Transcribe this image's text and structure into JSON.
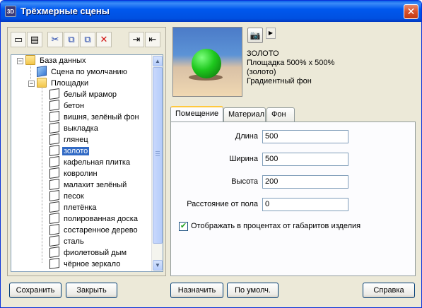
{
  "window": {
    "title": "Трёхмерные сцены",
    "app_icon_text": "3D",
    "close_glyph": "✕",
    "accent": "#0054e3"
  },
  "toolbar": {
    "buttons": [
      {
        "name": "new-icon",
        "glyph": "▭"
      },
      {
        "name": "open-folder-icon",
        "glyph": "▤"
      },
      {
        "name": "cut-icon",
        "glyph": "✂"
      },
      {
        "name": "copy-icon",
        "glyph": "⧉"
      },
      {
        "name": "paste-icon",
        "glyph": "⧉"
      },
      {
        "name": "delete-icon",
        "glyph": "✕"
      },
      {
        "name": "export-icon",
        "glyph": "⇥"
      },
      {
        "name": "import-icon",
        "glyph": "⇤"
      }
    ]
  },
  "tree": {
    "root": "База данных",
    "default_scene": "Сцена по умолчанию",
    "group": "Площадки",
    "items": [
      "белый мрамор",
      "бетон",
      "вишня, зелёный фон",
      "выкладка",
      "глянец",
      "золото",
      "кафельная плитка",
      "ковролин",
      "малахит зелёный",
      "песок",
      "плетёнка",
      "полированная доска",
      "состаренное дерево",
      "сталь",
      "фиолетовый дым",
      "чёрное зеркало"
    ],
    "selected": "золото",
    "expander_minus": "−"
  },
  "scene_info": {
    "name": "ЗОЛОТО",
    "size_line": "Площадка  500% x 500%",
    "material_line": "(золото)",
    "background_line": "Градиентный фон",
    "camera_glyph": "📷",
    "arrow_glyph": "▶"
  },
  "tabs": [
    {
      "label": "Помещение",
      "active": true
    },
    {
      "label": "Материал",
      "active": false
    },
    {
      "label": "Фон",
      "active": false
    }
  ],
  "room": {
    "length_label": "Длина",
    "length_value": "500",
    "width_label": "Ширина",
    "width_value": "500",
    "height_label": "Высота",
    "height_value": "200",
    "floor_distance_label": "Расстояние от пола",
    "floor_distance_value": "0",
    "percent_checkbox_label": "Отображать в процентах от габаритов изделия",
    "percent_checkbox_checked": true,
    "check_glyph": "✔"
  },
  "buttons": {
    "save": "Сохранить",
    "close": "Закрыть",
    "assign": "Назначить",
    "default": "По умолч.",
    "help": "Справка"
  },
  "scrollbar": {
    "up": "▲",
    "down": "▼"
  }
}
